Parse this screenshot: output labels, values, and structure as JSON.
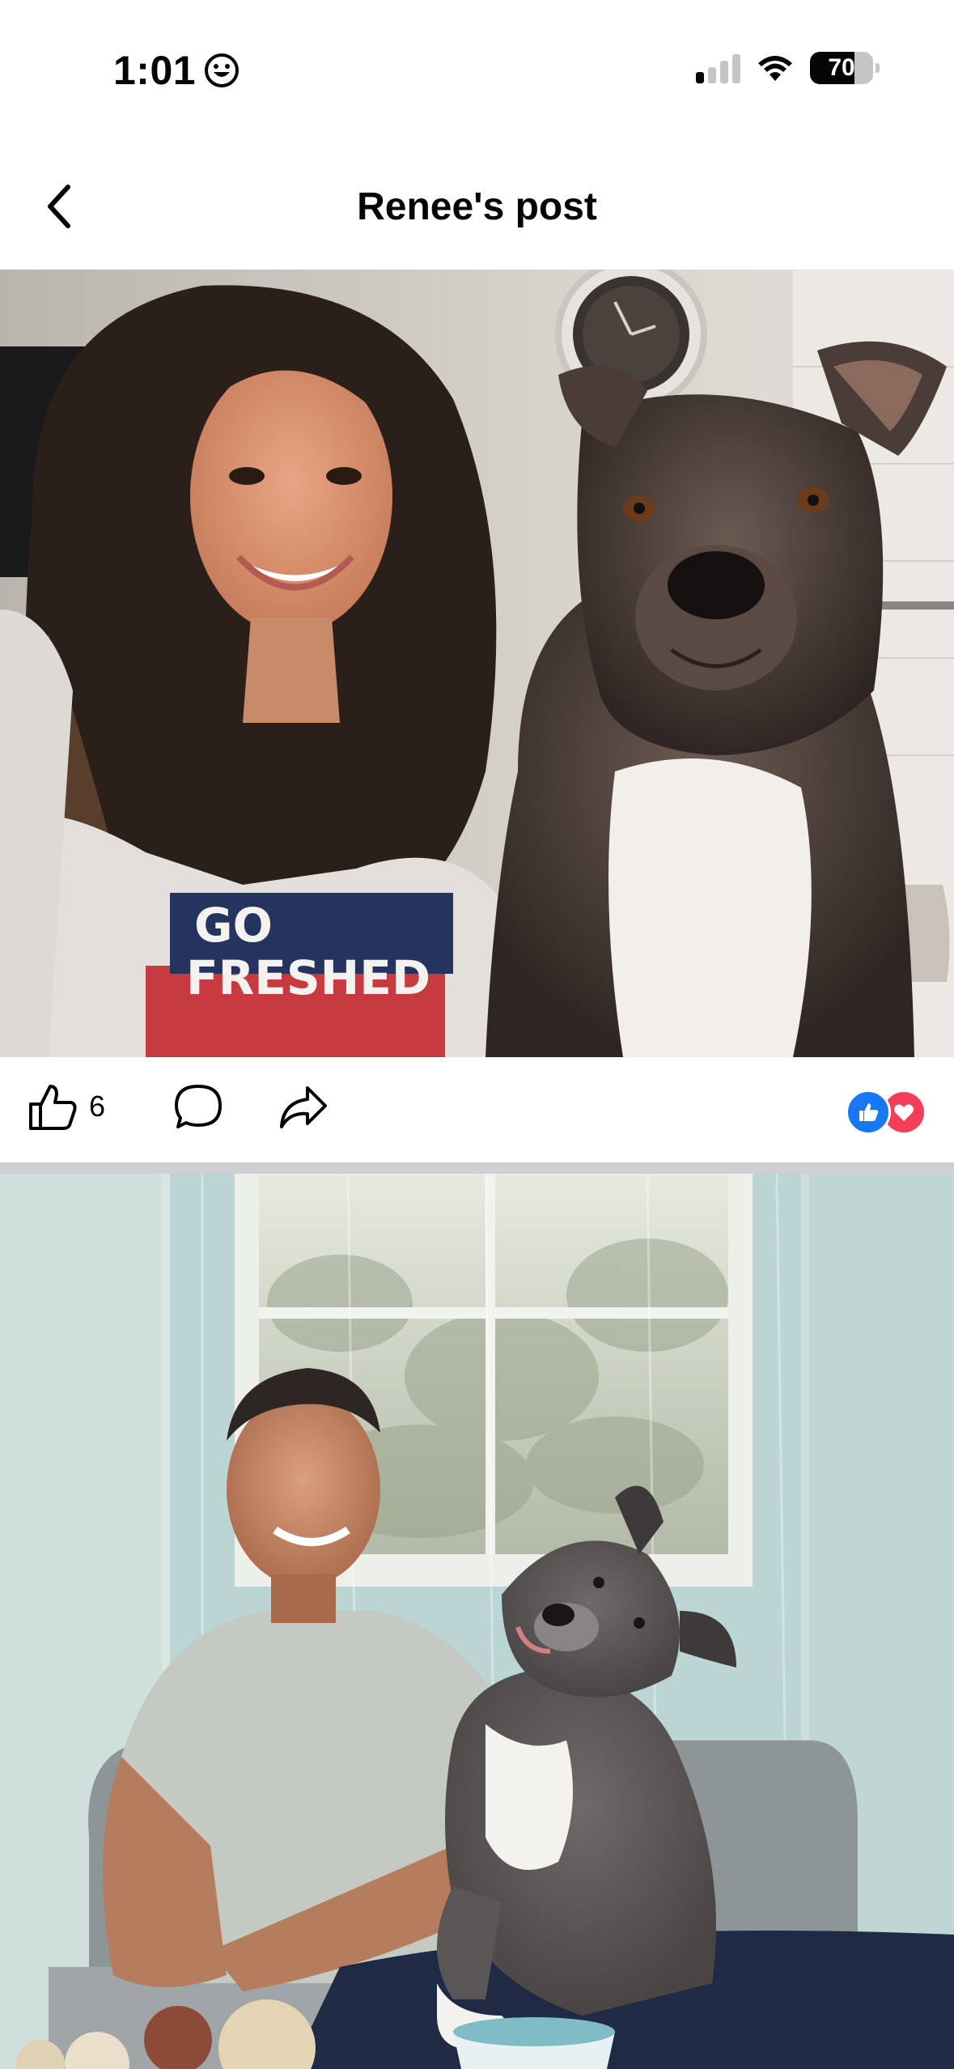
{
  "status_bar": {
    "time": "1:01",
    "battery_level": "70",
    "battery_fraction": 0.7,
    "signal_bars_active": 1,
    "signal_bars_total": 4,
    "emoji_icon": "smiley-face-icon",
    "wifi_icon": "wifi-icon"
  },
  "header": {
    "title": "Renee's post",
    "back_icon": "chevron-left-icon"
  },
  "posts": [
    {
      "image_description_icon": "photo-woman-with-dog",
      "actions": {
        "like_count": "6",
        "like_icon": "thumbs-up-icon",
        "comment_icon": "comment-bubble-icon",
        "share_icon": "share-arrow-icon"
      },
      "reactions": [
        "like-reaction-icon",
        "love-reaction-icon"
      ]
    },
    {
      "image_description_icon": "photo-man-with-dog"
    }
  ],
  "colors": {
    "facebook_blue": "#1877f2",
    "love_red": "#f33e58",
    "separator": "#ced0d4",
    "text": "#050505"
  }
}
